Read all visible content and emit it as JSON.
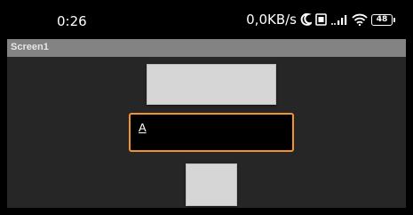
{
  "status_bar": {
    "time": "0:26",
    "network_speed": "0,0KB/s",
    "battery_level": "48",
    "icons": [
      "moon-icon",
      "sim-icon",
      "signal-icon",
      "wifi-icon",
      "battery-icon"
    ]
  },
  "title_bar": {
    "title": "Screen1"
  },
  "main": {
    "top_button_label": "",
    "text_field_value": "A",
    "bottom_button_label": ""
  },
  "colors": {
    "background": "#000000",
    "title_bar": "#838383",
    "content_background": "#262626",
    "button_face": "#d6d6d6",
    "focus_border": "#f5922f"
  }
}
